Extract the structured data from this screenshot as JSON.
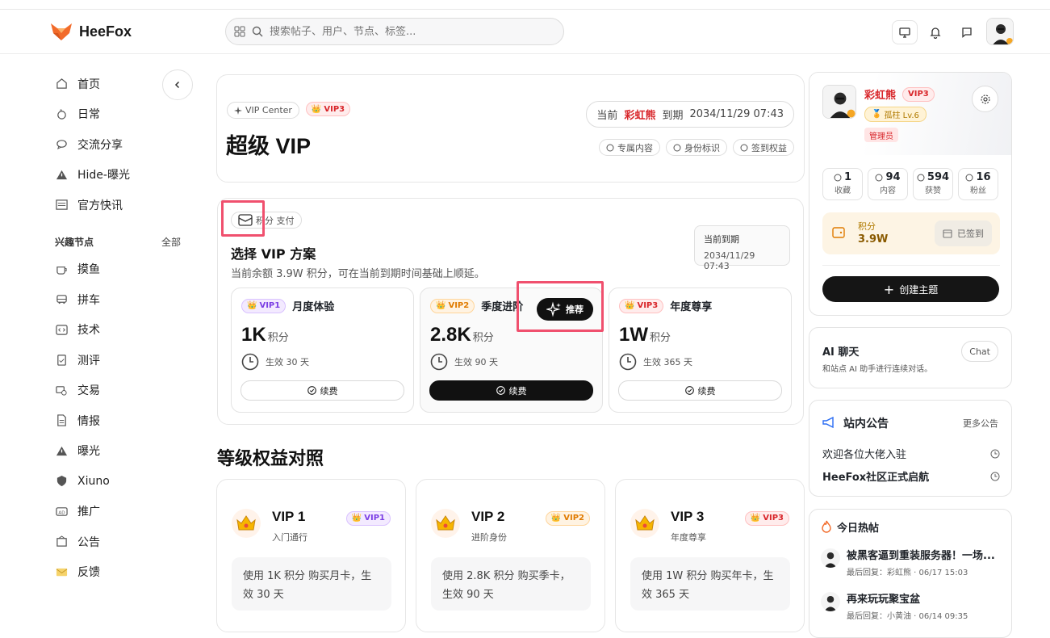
{
  "brand": {
    "name": "HeeFox"
  },
  "search": {
    "placeholder": "搜索帖子、用户、节点、标签..."
  },
  "sidebar": {
    "items": [
      {
        "label": "首页",
        "icon": "home-icon"
      },
      {
        "label": "日常",
        "icon": "coffee-icon"
      },
      {
        "label": "交流分享",
        "icon": "chat-icon"
      },
      {
        "label": "Hide-曝光",
        "icon": "warning-icon"
      }
    ],
    "news_item": {
      "label": "官方快讯",
      "icon": "news-icon"
    },
    "section_title": "兴趣节点",
    "section_all": "全部",
    "nodes": [
      {
        "label": "摸鱼",
        "icon": "cup-icon"
      },
      {
        "label": "拼车",
        "icon": "car-icon"
      },
      {
        "label": "技术",
        "icon": "code-icon"
      },
      {
        "label": "测评",
        "icon": "clipboard-icon"
      },
      {
        "label": "交易",
        "icon": "exchange-icon"
      },
      {
        "label": "情报",
        "icon": "document-icon"
      },
      {
        "label": "曝光",
        "icon": "warning-icon"
      },
      {
        "label": "Xiuno",
        "icon": "shield-icon"
      },
      {
        "label": "推广",
        "icon": "ad-icon"
      },
      {
        "label": "公告",
        "icon": "notice-icon"
      },
      {
        "label": "反馈",
        "icon": "mail-icon"
      }
    ]
  },
  "vip_header": {
    "center_label": "VIP Center",
    "badge": "VIP3",
    "title": "超级 VIP",
    "current_label": "当前",
    "user": "彩虹熊",
    "expire_label": "到期",
    "expire_date": "2034/11/29 07:43",
    "tags": [
      "专属内容",
      "身份标识",
      "签到权益"
    ]
  },
  "plan_section": {
    "pay_label": "积分 支付",
    "title": "选择 VIP 方案",
    "subtitle": "当前余额 3.9W 积分，可在当前到期时间基础上顺延。",
    "expiry_label": "当前到期",
    "expiry_value": "2034/11/29 07:43",
    "recommend": "推荐",
    "plans": [
      {
        "badge": "VIP1",
        "name": "月度体验",
        "price": "1K",
        "unit": "积分",
        "duration": "生效 30 天",
        "button": "续费"
      },
      {
        "badge": "VIP2",
        "name": "季度进阶",
        "price": "2.8K",
        "unit": "积分",
        "duration": "生效 90 天",
        "button": "续费"
      },
      {
        "badge": "VIP3",
        "name": "年度尊享",
        "price": "1W",
        "unit": "积分",
        "duration": "生效 365 天",
        "button": "续费"
      }
    ]
  },
  "compare": {
    "title": "等级权益对照",
    "tiers": [
      {
        "name": "VIP 1",
        "sub": "入门通行",
        "badge": "VIP1",
        "desc": "使用 1K 积分 购买月卡，生效 30 天"
      },
      {
        "name": "VIP 2",
        "sub": "进阶身份",
        "badge": "VIP2",
        "desc": "使用 2.8K 积分 购买季卡，生效 90 天"
      },
      {
        "name": "VIP 3",
        "sub": "年度尊享",
        "badge": "VIP3",
        "desc": "使用 1W 积分 购买年卡，生效 365 天"
      }
    ]
  },
  "profile": {
    "name": "彩虹熊",
    "badge": "VIP3",
    "level": "孤柱 Lv.6",
    "role": "管理员",
    "stats": [
      {
        "n": "1",
        "l": "收藏"
      },
      {
        "n": "94",
        "l": "内容"
      },
      {
        "n": "594",
        "l": "获赞"
      },
      {
        "n": "16",
        "l": "粉丝"
      }
    ],
    "points_label": "积分",
    "points_value": "3.9W",
    "checked_in": "已签到",
    "create_button": "创建主题"
  },
  "ai_chat": {
    "title": "AI 聊天",
    "desc": "和站点 AI 助手进行连续对话。",
    "button": "Chat"
  },
  "notices": {
    "title": "站内公告",
    "more": "更多公告",
    "items": [
      "欢迎各位大佬入驻",
      "HeeFox社区正式启航"
    ]
  },
  "hot": {
    "title": "今日热帖",
    "items": [
      {
        "title": "被黑客逼到重装服务器！一场...",
        "meta": "最后回复：彩虹熊 · 06/17 15:03"
      },
      {
        "title": "再来玩玩聚宝盆",
        "meta": "最后回复：小黄油 · 06/14 09:35"
      }
    ]
  },
  "colors": {
    "accent": "#111111",
    "brand": "#f26b2a",
    "danger": "#d8262a",
    "highlight": "#f0506e"
  }
}
